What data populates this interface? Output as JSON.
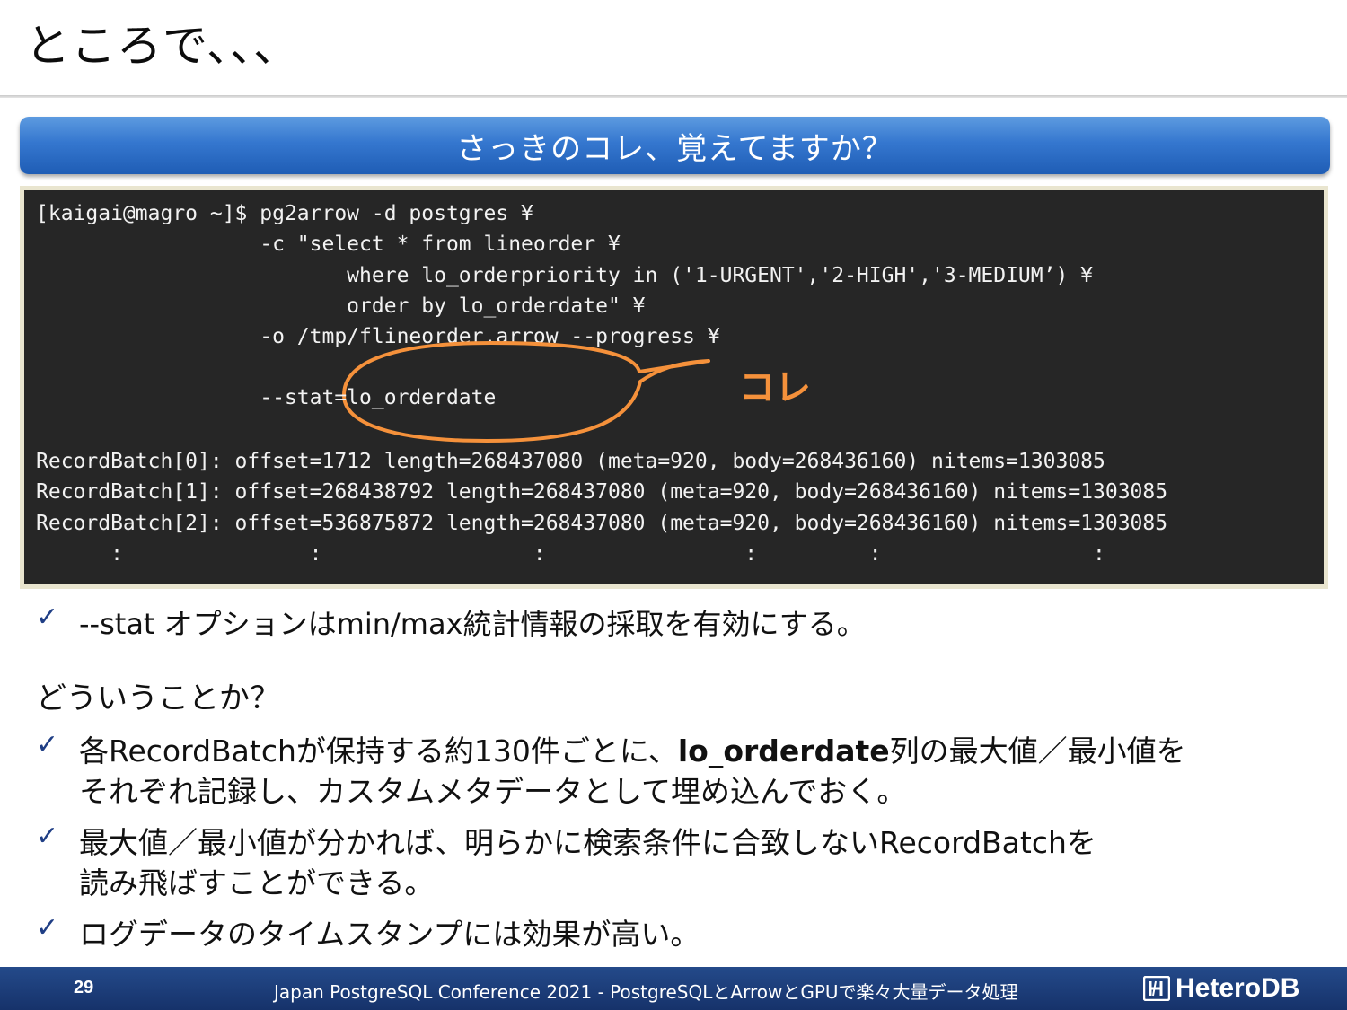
{
  "title": "ところで、、、",
  "banner": "さっきのコレ、覚えてますか？",
  "terminal": {
    "lines": [
      "[kaigai@magro ~]$ pg2arrow -d postgres ¥",
      "                  -c \"select * from lineorder ¥",
      "                         where lo_orderpriority in ('1-URGENT','2-HIGH','3-MEDIUM’) ¥",
      "                         order by lo_orderdate\" ¥",
      "                  -o /tmp/flineorder.arrow --progress ¥",
      "                  --stat=lo_orderdate",
      "RecordBatch[0]: offset=1712 length=268437080 (meta=920, body=268436160) nitems=1303085",
      "RecordBatch[1]: offset=268438792 length=268437080 (meta=920, body=268436160) nitems=1303085",
      "RecordBatch[2]: offset=536875872 length=268437080 (meta=920, body=268436160) nitems=1303085",
      "      :               :                 :                :         :                 :"
    ],
    "callout_label": "コレ",
    "callout_color": "#f5913b"
  },
  "bullets": {
    "check_glyph": "✓",
    "b1": "--stat オプションはmin/max統計情報の採取を有効にする。",
    "question": "どういうことか？",
    "b2_pre": "各RecordBatchが保持する約130件ごとに、",
    "b2_bold": "lo_orderdate",
    "b2_post": "列の最大値／最小値を",
    "b2_line2": "それぞれ記録し、カスタムメタデータとして埋め込んでおく。",
    "b3_line1": "最大値／最小値が分かれば、明らかに検索条件に合致しないRecordBatchを",
    "b3_line2": "読み飛ばすことができる。",
    "b4": "ログデータのタイムスタンプには効果が高い。"
  },
  "footer": {
    "page_number": "29",
    "text": "Japan PostgreSQL Conference 2021 - PostgreSQLとArrowとGPUで楽々大量データ処理",
    "logo_text": "HeteroDB",
    "background": "#1c3d7a"
  }
}
